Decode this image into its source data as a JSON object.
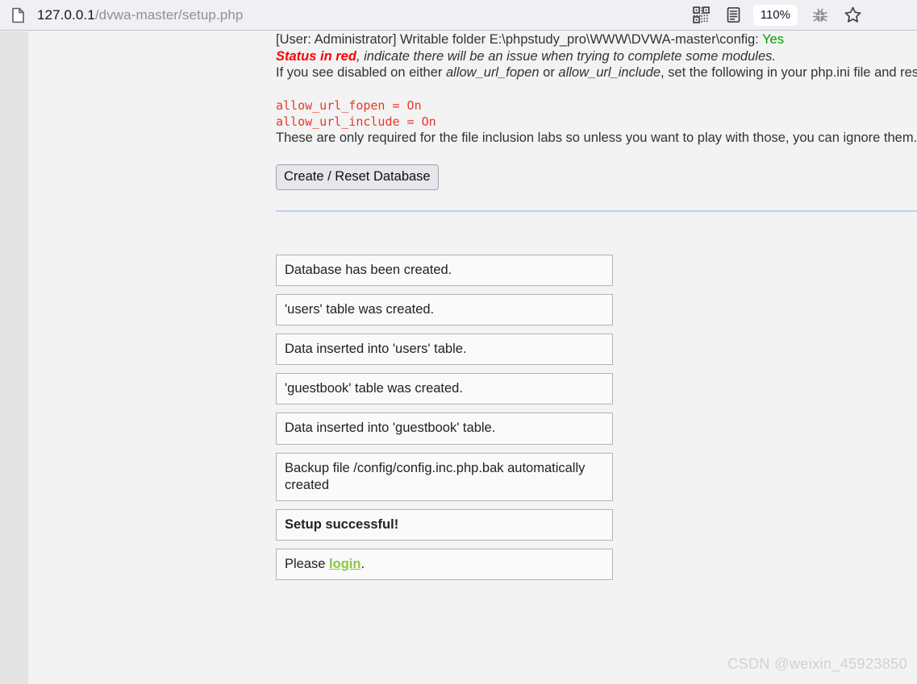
{
  "browser": {
    "url_host": "127.0.0.1",
    "url_path": "/dvwa-master/setup.php",
    "page_icon": "document-icon",
    "actions": [
      {
        "name": "qr-code-icon",
        "label": "QR code"
      },
      {
        "name": "reader-view-icon",
        "label": "Reader view"
      },
      {
        "name": "zoom-level-badge",
        "label": "110%"
      },
      {
        "name": "bug-icon",
        "label": "Debugger"
      },
      {
        "name": "bookmark-star-icon",
        "label": "Bookmark"
      }
    ],
    "zoom_level": "110%"
  },
  "page": {
    "writable_line": {
      "prefix": "[User: Administrator] Writable folder E:\\phpstudy_pro\\WWW\\DVWA-master\\config: ",
      "value": "Yes",
      "value_color": "#04a004"
    },
    "status_note": {
      "emphasis": "Status in red",
      "rest": ", indicate there will be an issue when trying to complete some modules.",
      "emphasis_color": "#ff0000"
    },
    "phpini_note": {
      "part1": "If you see disabled on either ",
      "em1": "allow_url_fopen",
      "part2": " or ",
      "em2": "allow_url_include",
      "part3": ", set the following in your php.ini file and restart Apache."
    },
    "ini_directives": "allow_url_fopen = On\nallow_url_include = On",
    "ini_color": "#e8382c",
    "inclusion_note": "These are only required for the file inclusion labs so unless you want to play with those, you can ignore them.",
    "reset_button": "Create / Reset Database",
    "divider_color": "#bfcdf5",
    "messages": [
      {
        "text": "Database has been created.",
        "bold": false
      },
      {
        "text": "'users' table was created.",
        "bold": false
      },
      {
        "text": "Data inserted into 'users' table.",
        "bold": false
      },
      {
        "text": "'guestbook' table was created.",
        "bold": false
      },
      {
        "text": "Data inserted into 'guestbook' table.",
        "bold": false
      },
      {
        "text": "Backup file /config/config.inc.php.bak automatically created",
        "bold": false
      },
      {
        "text": "Setup successful!",
        "bold": true
      }
    ],
    "login_message": {
      "prefix": "Please ",
      "link": "login",
      "suffix": ".",
      "link_color": "#8cc63f"
    }
  },
  "watermark": "CSDN @weixin_45923850"
}
